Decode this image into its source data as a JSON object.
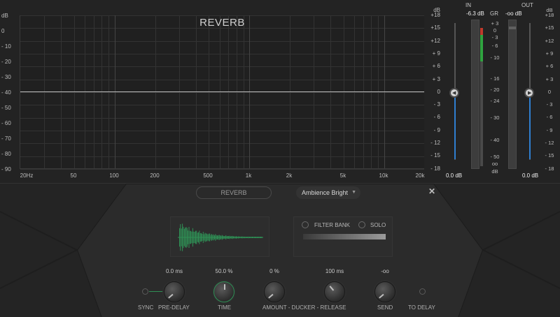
{
  "graph": {
    "title": "REVERB",
    "left_ticks": [
      "dB",
      "0",
      "- 10",
      "- 20",
      "- 30",
      "- 40",
      "- 50",
      "- 60",
      "- 70",
      "- 80",
      "- 90"
    ],
    "right_ticks": [
      "dB",
      "+18",
      "+15",
      "+12",
      "+ 9",
      "+ 6",
      "+ 3",
      "0",
      "- 3",
      "- 6",
      "- 9",
      "- 12",
      "- 15",
      "- 18"
    ],
    "freq_ticks": [
      "20Hz",
      "50",
      "100",
      "200",
      "500",
      "1k",
      "2k",
      "5k",
      "10k",
      "20k"
    ]
  },
  "meters": {
    "in_label": "IN",
    "out_label": "OUT",
    "gr_label": "GR",
    "in_peak": "-6.3 dB",
    "out_peak": "-oo dB",
    "gr_ticks": [
      "+ 3",
      "0",
      "- 3",
      "- 6",
      "- 10",
      "- 16",
      "- 20",
      "- 24",
      "- 30",
      "- 40",
      "- 50",
      "oo",
      "dB"
    ],
    "out_scale": [
      "dB",
      "+18",
      "+15",
      "+12",
      "+ 9",
      "+ 6",
      "+ 3",
      "0",
      "- 3",
      "- 6",
      "- 9",
      "- 12",
      "- 15",
      "- 18"
    ],
    "in_gain": "0.0 dB",
    "out_gain": "0.0 dB",
    "in_knob_icon": "arrow-left-icon",
    "out_knob_icon": "arrow-right-icon",
    "accent_blue": "#2f7fd0",
    "meter_green": "#2fa33f",
    "meter_red": "#c0392b"
  },
  "panel": {
    "tab_label": "REVERB",
    "preset": "Ambience Bright",
    "close_icon": "close-icon",
    "filter_bank_label": "FILTER BANK",
    "solo_label": "SOLO",
    "waveform_color": "#2f8f55",
    "knobs": [
      {
        "label": "SYNC",
        "value": ""
      },
      {
        "label": "PRE-DELAY",
        "value": "0.0 ms"
      },
      {
        "label": "TIME",
        "value": "50.0 %"
      },
      {
        "label": "AMOUNT - DUCKER - RELEASE",
        "value": "0 %"
      },
      {
        "label": "",
        "value": "100 ms"
      },
      {
        "label": "SEND",
        "value": "-oo"
      },
      {
        "label": "TO DELAY",
        "value": ""
      }
    ]
  }
}
